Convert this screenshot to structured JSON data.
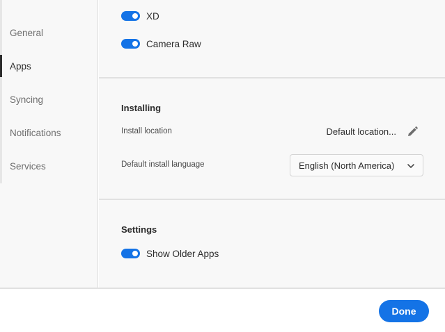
{
  "sidebar": {
    "items": [
      {
        "label": "General"
      },
      {
        "label": "Apps"
      },
      {
        "label": "Syncing"
      },
      {
        "label": "Notifications"
      },
      {
        "label": "Services"
      }
    ],
    "active": "Apps"
  },
  "apps": {
    "toggles": [
      {
        "label": "XD",
        "on": true
      },
      {
        "label": "Camera Raw",
        "on": true
      }
    ]
  },
  "installing": {
    "title": "Installing",
    "location_label": "Install location",
    "location_value": "Default location...",
    "language_label": "Default install language",
    "language_value": "English (North America)"
  },
  "settings": {
    "title": "Settings",
    "show_older_apps_label": "Show Older Apps",
    "show_older_apps_on": true
  },
  "footer": {
    "done_label": "Done"
  },
  "colors": {
    "accent": "#1473e6",
    "background": "#f8f8f8"
  },
  "icons": {
    "edit": "pencil-icon",
    "dropdown": "chevron-down-icon"
  }
}
